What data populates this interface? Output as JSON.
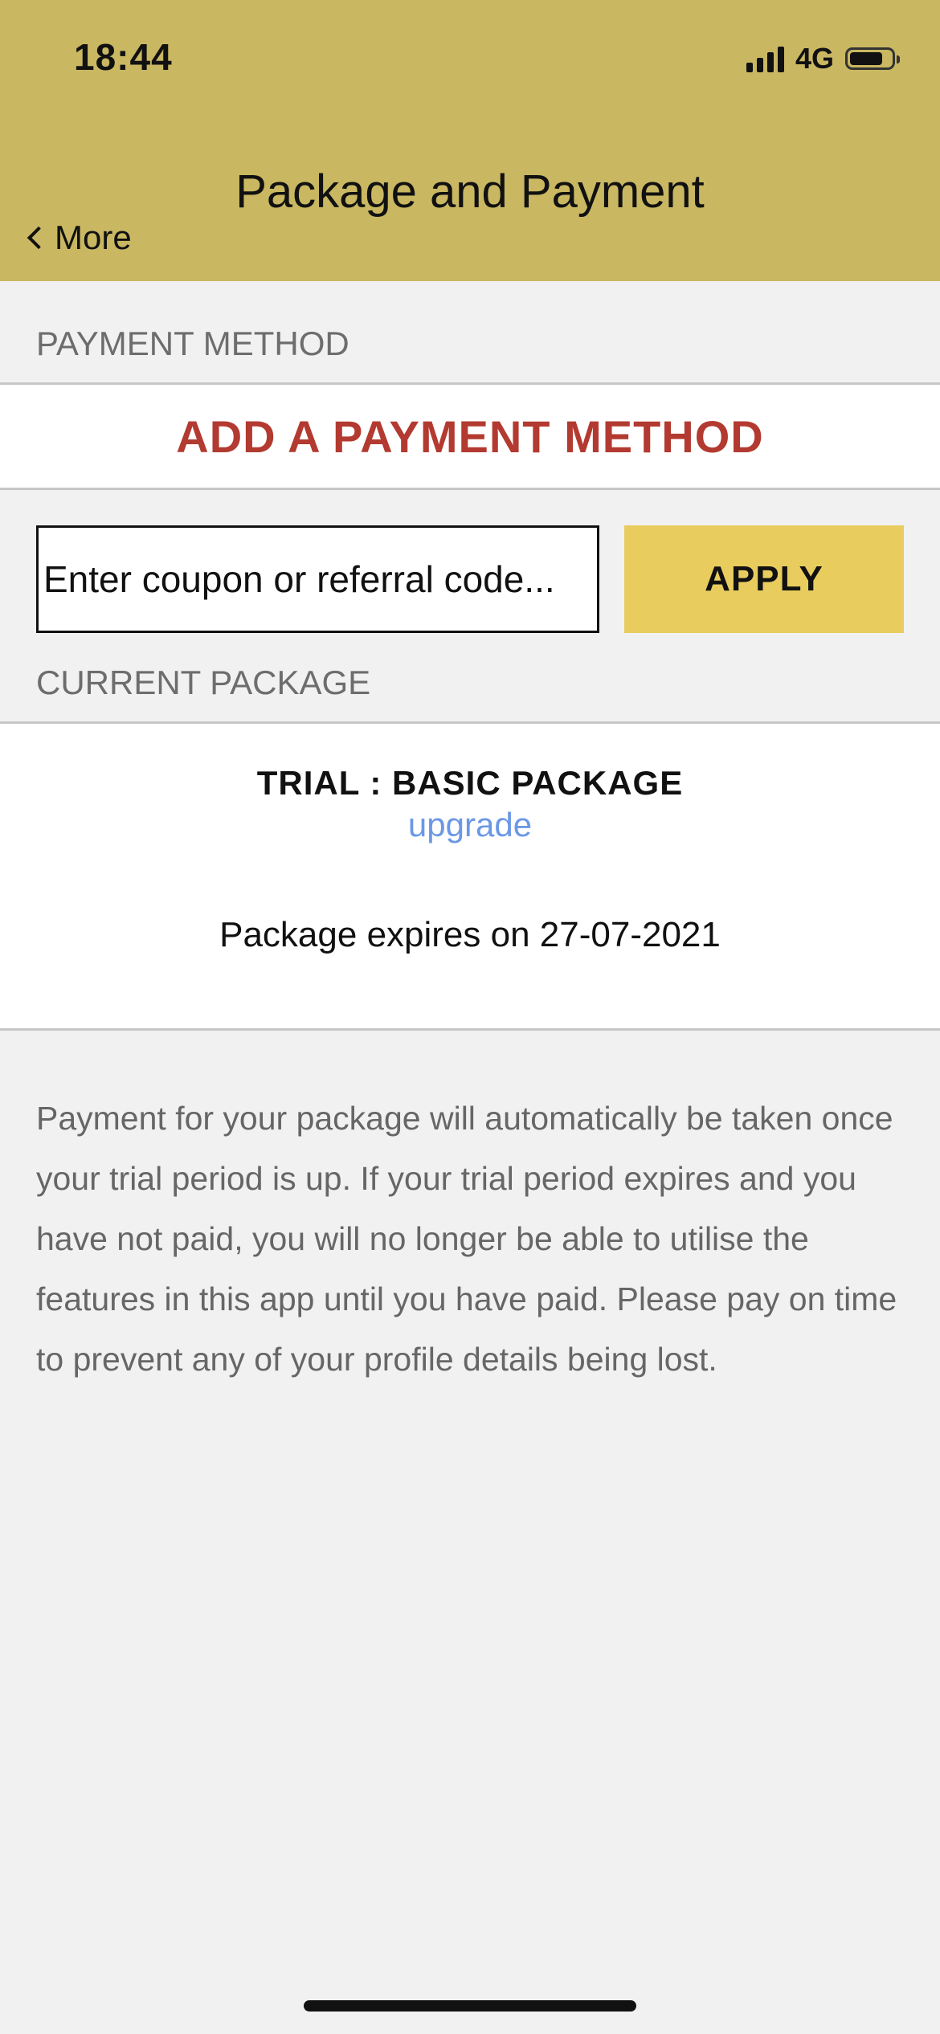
{
  "status_bar": {
    "time": "18:44",
    "network": "4G",
    "battery_level": 0.8
  },
  "header": {
    "title": "Package and Payment",
    "back_label": "More"
  },
  "payment_method": {
    "section_label": "PAYMENT METHOD",
    "add_label": "ADD A PAYMENT METHOD"
  },
  "coupon": {
    "placeholder": "Enter coupon or referral code...",
    "value": "",
    "apply_label": "APPLY"
  },
  "current_package": {
    "section_label": "CURRENT PACKAGE",
    "name": "TRIAL : BASIC PACKAGE",
    "upgrade_label": "upgrade",
    "expiry_text": "Package expires on 27-07-2021"
  },
  "info": {
    "text": "Payment for your package will automatically be taken once your trial period is up. If your trial period expires and you have not paid, you will no longer be able to utilise the features in this app until you have paid. Please pay on time to prevent any of your profile details being lost."
  },
  "colors": {
    "header_bg": "#c9b762",
    "accent_red": "#b33a30",
    "apply_bg": "#e8cd5e",
    "link_blue": "#6b98e6"
  }
}
